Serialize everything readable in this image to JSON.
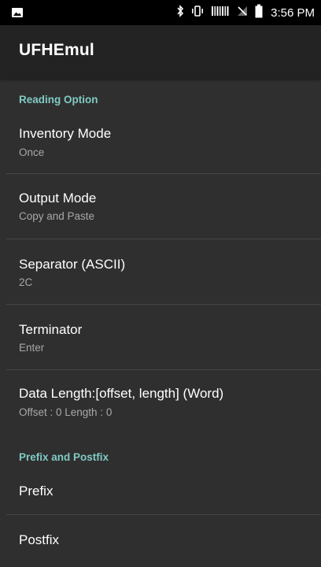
{
  "status_bar": {
    "time": "3:56 PM",
    "icons": [
      "image-icon",
      "bluetooth-icon",
      "vibrate-icon",
      "signal-icon",
      "no-sim-icon",
      "battery-icon"
    ]
  },
  "app_bar": {
    "title": "UFHEmul"
  },
  "sections": {
    "reading": {
      "header": "Reading Option",
      "inventory_mode": {
        "title": "Inventory Mode",
        "summary": "Once"
      },
      "output_mode": {
        "title": "Output Mode",
        "summary": "Copy and Paste"
      },
      "separator": {
        "title": "Separator (ASCII)",
        "summary": "2C"
      },
      "terminator": {
        "title": "Terminator",
        "summary": "Enter"
      },
      "data_length": {
        "title": "Data Length:[offset, length] (Word)",
        "summary": "Offset : 0 Length : 0"
      }
    },
    "prefix_postfix": {
      "header": "Prefix and Postfix",
      "prefix": {
        "title": "Prefix"
      },
      "postfix": {
        "title": "Postfix"
      }
    }
  },
  "colors": {
    "accent": "#80cbc4",
    "background": "#2f2f2f",
    "app_bar": "#232323",
    "status_bar": "#000000"
  }
}
